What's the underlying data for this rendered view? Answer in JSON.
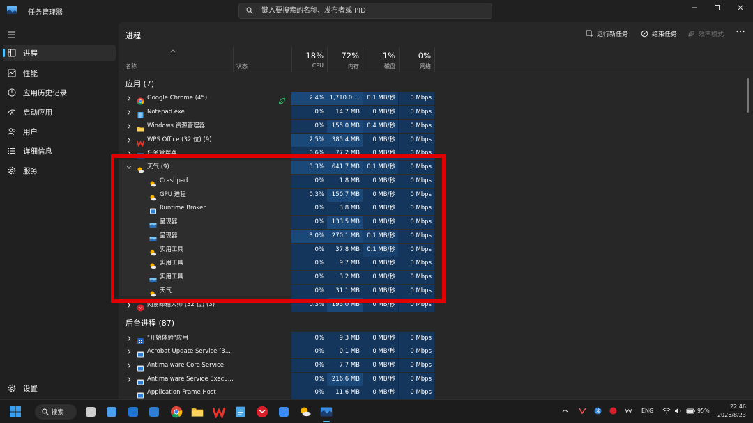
{
  "window": {
    "title": "任务管理器",
    "search_placeholder": "键入要搜索的名称、发布者或 PID",
    "controls": {
      "minimize": "minimize-icon",
      "maximize": "maximize-icon",
      "close": "close-icon"
    }
  },
  "sidebar": {
    "items": [
      {
        "label": "进程",
        "icon": "processes-icon",
        "active": true
      },
      {
        "label": "性能",
        "icon": "performance-icon"
      },
      {
        "label": "应用历史记录",
        "icon": "app-history-icon"
      },
      {
        "label": "启动应用",
        "icon": "startup-apps-icon"
      },
      {
        "label": "用户",
        "icon": "users-icon"
      },
      {
        "label": "详细信息",
        "icon": "details-icon"
      },
      {
        "label": "服务",
        "icon": "services-icon"
      }
    ],
    "settings_label": "设置"
  },
  "page": {
    "title": "进程",
    "toolbar": {
      "run_new_task": "运行新任务",
      "end_task": "结束任务",
      "efficiency_mode": "效率模式",
      "more": "more-icon"
    }
  },
  "columns": {
    "name": "名称",
    "status": "状态",
    "cpu": {
      "percent": "18%",
      "label": "CPU"
    },
    "memory": {
      "percent": "72%",
      "label": "内存"
    },
    "disk": {
      "percent": "1%",
      "label": "磁盘"
    },
    "network": {
      "percent": "0%",
      "label": "网络"
    }
  },
  "groups": {
    "apps": "应用 (7)",
    "background": "后台进程 (87)"
  },
  "processes": [
    {
      "name": "Google Chrome (45)",
      "icon": "chrome-icon",
      "expand": "collapsed",
      "cpu": "2.4%",
      "mem": "1,710.0 ...",
      "disk": "0.1 MB/秒",
      "net": "0 Mbps",
      "status_icon": "efficiency-leaf-icon",
      "level": 0
    },
    {
      "name": "Notepad.exe",
      "icon": "notepad-icon",
      "expand": "collapsed",
      "cpu": "0%",
      "mem": "14.7 MB",
      "disk": "0 MB/秒",
      "net": "0 Mbps",
      "level": 0
    },
    {
      "name": "Windows 资源管理器",
      "icon": "folder-icon",
      "expand": "collapsed",
      "cpu": "0%",
      "mem": "155.0 MB",
      "disk": "0.4 MB/秒",
      "net": "0 Mbps",
      "level": 0
    },
    {
      "name": "WPS Office (32 位) (9)",
      "icon": "wps-icon",
      "expand": "collapsed",
      "cpu": "2.5%",
      "mem": "385.4 MB",
      "disk": "0 MB/秒",
      "net": "0 Mbps",
      "level": 0
    },
    {
      "name": "任务管理器",
      "icon": "task-manager-icon",
      "expand": "collapsed",
      "cpu": "0.6%",
      "mem": "77.2 MB",
      "disk": "0 MB/秒",
      "net": "0 Mbps",
      "level": 0
    },
    {
      "name": "天气 (9)",
      "icon": "weather-icon",
      "expand": "expanded",
      "cpu": "3.3%",
      "mem": "641.7 MB",
      "disk": "0.1 MB/秒",
      "net": "0 Mbps",
      "level": 0
    },
    {
      "name": "Crashpad",
      "icon": "weather-icon",
      "cpu": "0%",
      "mem": "1.8 MB",
      "disk": "0 MB/秒",
      "net": "0 Mbps",
      "level": 1
    },
    {
      "name": "GPU 进程",
      "icon": "weather-icon",
      "cpu": "0.3%",
      "mem": "150.7 MB",
      "disk": "0 MB/秒",
      "net": "0 Mbps",
      "level": 1
    },
    {
      "name": "Runtime Broker",
      "icon": "runtime-broker-icon",
      "cpu": "0%",
      "mem": "3.8 MB",
      "disk": "0 MB/秒",
      "net": "0 Mbps",
      "level": 1
    },
    {
      "name": "呈现器",
      "icon": "renderer-icon",
      "cpu": "0%",
      "mem": "133.5 MB",
      "disk": "0 MB/秒",
      "net": "0 Mbps",
      "level": 1
    },
    {
      "name": "呈现器",
      "icon": "renderer-icon",
      "cpu": "3.0%",
      "mem": "270.1 MB",
      "disk": "0.1 MB/秒",
      "net": "0 Mbps",
      "level": 1
    },
    {
      "name": "实用工具",
      "icon": "weather-icon",
      "cpu": "0%",
      "mem": "37.8 MB",
      "disk": "0.1 MB/秒",
      "net": "0 Mbps",
      "level": 1
    },
    {
      "name": "实用工具",
      "icon": "weather-icon",
      "cpu": "0%",
      "mem": "9.7 MB",
      "disk": "0 MB/秒",
      "net": "0 Mbps",
      "level": 1
    },
    {
      "name": "实用工具",
      "icon": "renderer-icon",
      "cpu": "0%",
      "mem": "3.2 MB",
      "disk": "0 MB/秒",
      "net": "0 Mbps",
      "level": 1
    },
    {
      "name": "天气",
      "icon": "weather-icon",
      "cpu": "0%",
      "mem": "31.1 MB",
      "disk": "0 MB/秒",
      "net": "0 Mbps",
      "level": 1
    },
    {
      "name": "网易邮箱大师 (32 位) (3)",
      "icon": "netease-mail-icon",
      "expand": "collapsed",
      "cpu": "0.3%",
      "mem": "195.0 MB",
      "disk": "0 MB/秒",
      "net": "0 Mbps",
      "level": 0
    },
    {
      "name": "\"开始体验\"应用",
      "icon": "start-experience-icon",
      "expand": "collapsed",
      "cpu": "0%",
      "mem": "9.3 MB",
      "disk": "0 MB/秒",
      "net": "0 Mbps",
      "level": 0
    },
    {
      "name": "Acrobat Update Service (3...",
      "icon": "service-window-icon",
      "expand": "collapsed",
      "cpu": "0%",
      "mem": "0.1 MB",
      "disk": "0 MB/秒",
      "net": "0 Mbps",
      "level": 0
    },
    {
      "name": "Antimalware Core Service",
      "icon": "service-window-icon",
      "expand": "collapsed",
      "cpu": "0%",
      "mem": "7.7 MB",
      "disk": "0 MB/秒",
      "net": "0 Mbps",
      "level": 0
    },
    {
      "name": "Antimalware Service Execu...",
      "icon": "service-window-icon",
      "expand": "collapsed",
      "cpu": "0%",
      "mem": "216.6 MB",
      "disk": "0 MB/秒",
      "net": "0 Mbps",
      "level": 0
    },
    {
      "name": "Application Frame Host",
      "icon": "service-window-icon",
      "cpu": "0%",
      "mem": "11.6 MB",
      "disk": "0 MB/秒",
      "net": "0 Mbps",
      "level": 0
    }
  ],
  "taskbar": {
    "search_label": "搜索",
    "apps": [
      "start-icon",
      "search-icon",
      "task-view-icon",
      "copilot-icon",
      "outlook-icon",
      "store-icon",
      "chrome-icon",
      "file-explorer-icon",
      "wps-icon",
      "notepad-icon",
      "netease-mail-icon",
      "feishu-icon",
      "weather-icon",
      "task-manager-icon"
    ],
    "tray": {
      "language": "ENG",
      "battery": "95%",
      "time": "22:46",
      "date": "2026/8/23"
    }
  }
}
